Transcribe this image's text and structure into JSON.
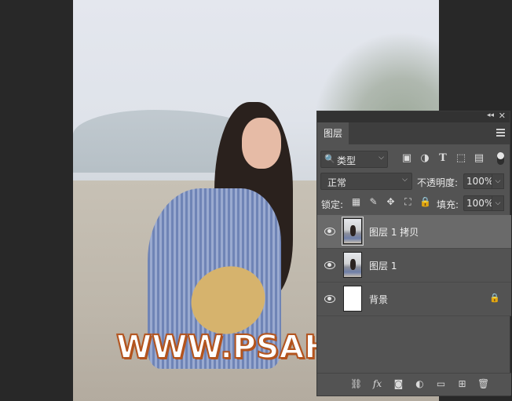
{
  "watermark": {
    "text": "WWW.PSAHZ.COM"
  },
  "panel": {
    "topbar": {
      "collapse_glyph": "◂◂",
      "close_glyph": "✕"
    },
    "tab_label": "图层",
    "filter": {
      "label": "类型",
      "search_glyph": "🔍",
      "chevron": "⌵"
    },
    "filter_icons": [
      "image-filter-icon",
      "adjustment-filter-icon",
      "type-filter-icon",
      "shape-filter-icon",
      "smart-object-filter-icon"
    ],
    "blend_mode": "正常",
    "opacity_label": "不透明度:",
    "opacity_value": "100%",
    "lock_label": "锁定:",
    "fill_label": "填充:",
    "fill_value": "100%",
    "layers": [
      {
        "name": "图层 1 拷贝",
        "selected": true,
        "thumb": "photo",
        "locked": false
      },
      {
        "name": "图层 1",
        "selected": false,
        "thumb": "photo",
        "locked": false
      },
      {
        "name": "背景",
        "selected": false,
        "thumb": "white",
        "locked": true
      }
    ],
    "bottom_icons": [
      "link-layers-icon",
      "fx-icon",
      "mask-icon",
      "adjustment-layer-icon",
      "group-folder-icon",
      "new-layer-icon",
      "trash-icon"
    ],
    "fx_label": "fx"
  }
}
